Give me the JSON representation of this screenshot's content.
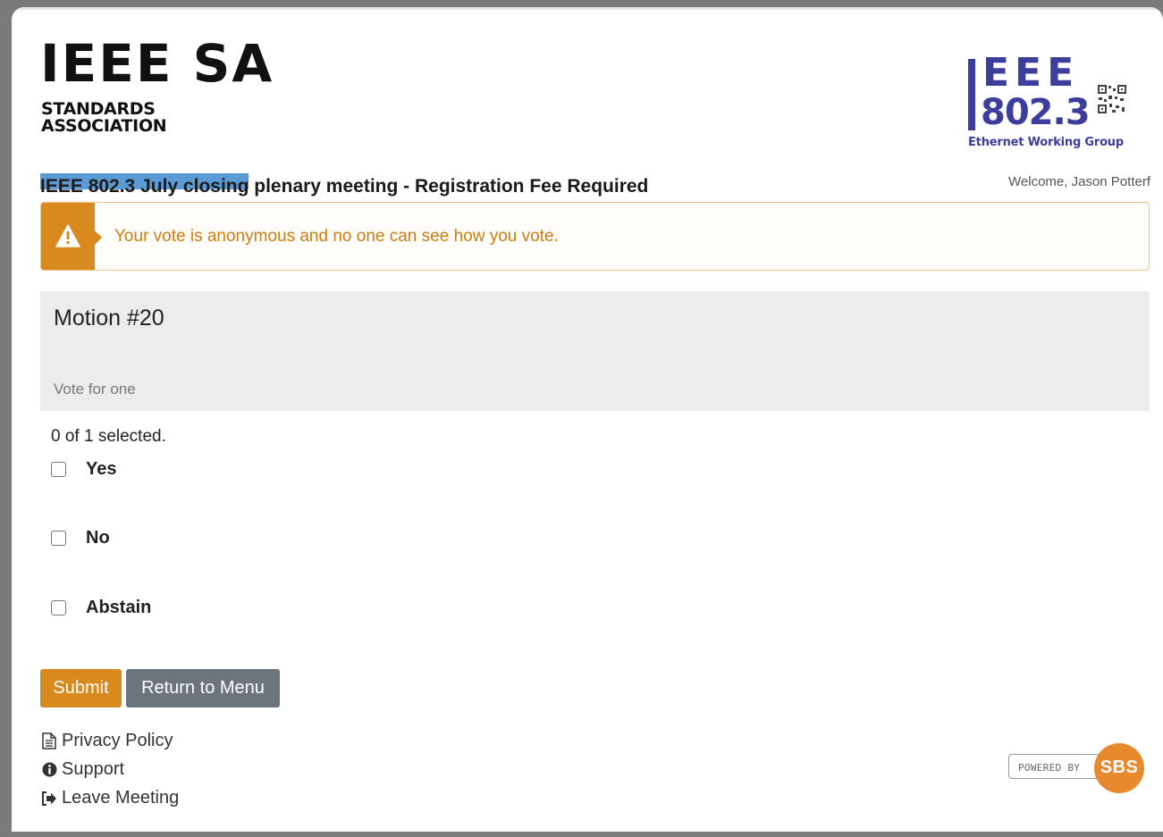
{
  "header": {
    "sa_logo_main": "IEEE SA",
    "sa_logo_line1": "STANDARDS",
    "sa_logo_line2": "ASSOCIATION",
    "group_logo_top": "EEE",
    "group_logo_num": "802.3",
    "group_logo_sub": "Ethernet Working Group",
    "meeting_title": "IEEE 802.3 July closing plenary meeting - Registration Fee Required",
    "welcome": "Welcome, Jason Potterf"
  },
  "alert": {
    "icon": "warning-icon",
    "text": "Your vote is anonymous and no one can see how you vote."
  },
  "motion": {
    "title": "Motion #20",
    "hint": "Vote for one"
  },
  "ballot": {
    "selection_count": "0 of 1 selected.",
    "options": [
      {
        "label": "Yes",
        "checked": false
      },
      {
        "label": "No",
        "checked": false
      },
      {
        "label": "Abstain",
        "checked": false
      }
    ]
  },
  "actions": {
    "submit_label": "Submit",
    "return_label": "Return to Menu"
  },
  "footer": {
    "links": [
      {
        "label": "Privacy Policy",
        "icon": "document-icon"
      },
      {
        "label": "Support",
        "icon": "info-icon"
      },
      {
        "label": "Leave Meeting",
        "icon": "sign-out-icon"
      }
    ],
    "powered_by": "POWERED BY",
    "powered_brand": "SBS"
  },
  "colors": {
    "accent": "#d98a1e",
    "secondary_button": "#6c757d",
    "ieee_blue": "#3d3d9e",
    "sa_bar": "#5b9bd5"
  }
}
